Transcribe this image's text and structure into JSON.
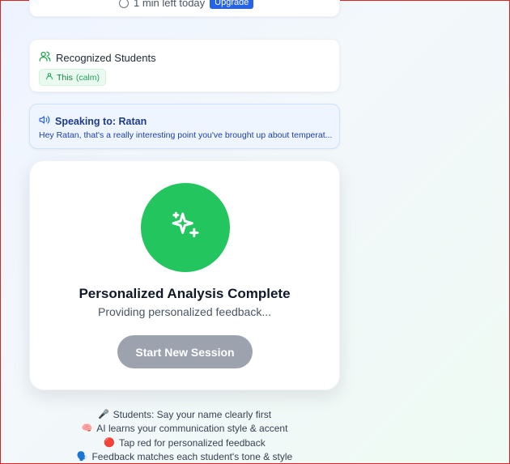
{
  "top": {
    "time_text": "1 min left today",
    "upgrade_label": "Upgrade"
  },
  "students": {
    "title": "Recognized Students",
    "chip_name": "This",
    "chip_mood": "(calm)"
  },
  "speaking": {
    "title": "Speaking to: Ratan",
    "message": "Hey Ratan, that's a really interesting point you've brought up about temperat..."
  },
  "analysis": {
    "title": "Personalized Analysis Complete",
    "subtitle": "Providing personalized feedback...",
    "button_label": "Start New Session",
    "accent": "#22c55e"
  },
  "tips": [
    {
      "icon": "🎤",
      "text": "Students: Say your name clearly first"
    },
    {
      "icon": "🧠",
      "text": "AI learns your communication style & accent"
    },
    {
      "icon": "🔴",
      "text": "Tap red for personalized feedback"
    },
    {
      "icon": "🗣️",
      "text": "Feedback matches each student's tone & style"
    }
  ]
}
